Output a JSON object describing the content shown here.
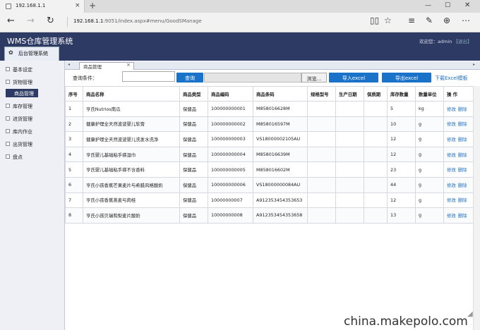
{
  "browser": {
    "tab_title": "192.168.1.1",
    "tab_close": "×",
    "new_tab": "+",
    "url_host": "192.168.1.1",
    "url_path": ":9051/index.aspx#menu/GoodSManage",
    "back": "←",
    "forward": "→",
    "refresh": "↻",
    "win_min": "—",
    "win_max": "☐",
    "win_close": "✕",
    "toolbar_icons": [
      "reading-view-icon",
      "favorite-star-icon",
      "hub-icon",
      "notes-icon",
      "share-icon",
      "more-icon"
    ]
  },
  "app": {
    "title": "WMS仓库管理系统",
    "welcome": "欢迎您：admin",
    "logout": "【退出】",
    "system_tab": "后台管理系统",
    "accent": "#2d3a63",
    "button_color": "#1b73c9"
  },
  "sidebar": {
    "items": [
      {
        "label": "基本设定"
      },
      {
        "label": "货物管理"
      },
      {
        "label": "商品管理",
        "active": true
      },
      {
        "label": "库存管理"
      },
      {
        "label": "进货管理"
      },
      {
        "label": "库内作业"
      },
      {
        "label": "出货管理"
      },
      {
        "label": "盘点"
      }
    ]
  },
  "content_tab": {
    "label": "商品管理",
    "close": "×",
    "nav_left": "◂",
    "nav_right": "▸"
  },
  "toolbar": {
    "query_label": "查询条件：",
    "query_value": "",
    "search_button": "查询",
    "browse_button": "浏览...",
    "import_button": "导入excel",
    "export_button": "导出excel",
    "template_link": "下载Excel模板"
  },
  "table": {
    "headers": [
      "序号",
      "商品名称",
      "商品类型",
      "商品编码",
      "商品条码",
      "规格型号",
      "生产日期",
      "保质期",
      "库存数量",
      "数量单位",
      "操 作"
    ],
    "edit_label": "修改",
    "delete_label": "删除",
    "rows": [
      [
        "1",
        "亨氏Nutrios南瓜",
        "保健品",
        "100000000001",
        "M858016628M",
        "",
        "",
        "",
        "5",
        "kg"
      ],
      [
        "2",
        "健康护理全天然波波婴儿软膏",
        "保健品",
        "100000000002",
        "M858016597M",
        "",
        "",
        "",
        "10",
        "g"
      ],
      [
        "3",
        "健康护理全天然波波婴儿洗发水洗净",
        "保健品",
        "100000000003",
        "VS18000002105AU",
        "",
        "",
        "",
        "12",
        "g"
      ],
      [
        "4",
        "亨氏婴儿基础粘手搽湿巾",
        "保健品",
        "100000000004",
        "M858016639M",
        "",
        "",
        "",
        "12",
        "g"
      ],
      [
        "5",
        "亨氏婴儿基础粘手搽不含香料",
        "保健品",
        "100000000005",
        "M858016602M",
        "",
        "",
        "",
        "23",
        "g"
      ],
      [
        "6",
        "亨氏小孩香蕉芒果麦片与希腊风格酸奶",
        "保健品",
        "100000000006",
        "VS18000000084AU",
        "",
        "",
        "",
        "44",
        "g"
      ],
      [
        "7",
        "亨氏小孩香蕉蒸麦与肉桂",
        "保健品",
        "10000000007",
        "A912353454353653",
        "",
        "",
        "",
        "12",
        "g"
      ],
      [
        "8",
        "亨氏小孩贝瑞和梨麦片酸奶",
        "保健品",
        "10000000008",
        "A912353454353658",
        "",
        "",
        "",
        "13",
        "g"
      ]
    ]
  },
  "watermark": "china.makepolo.com"
}
